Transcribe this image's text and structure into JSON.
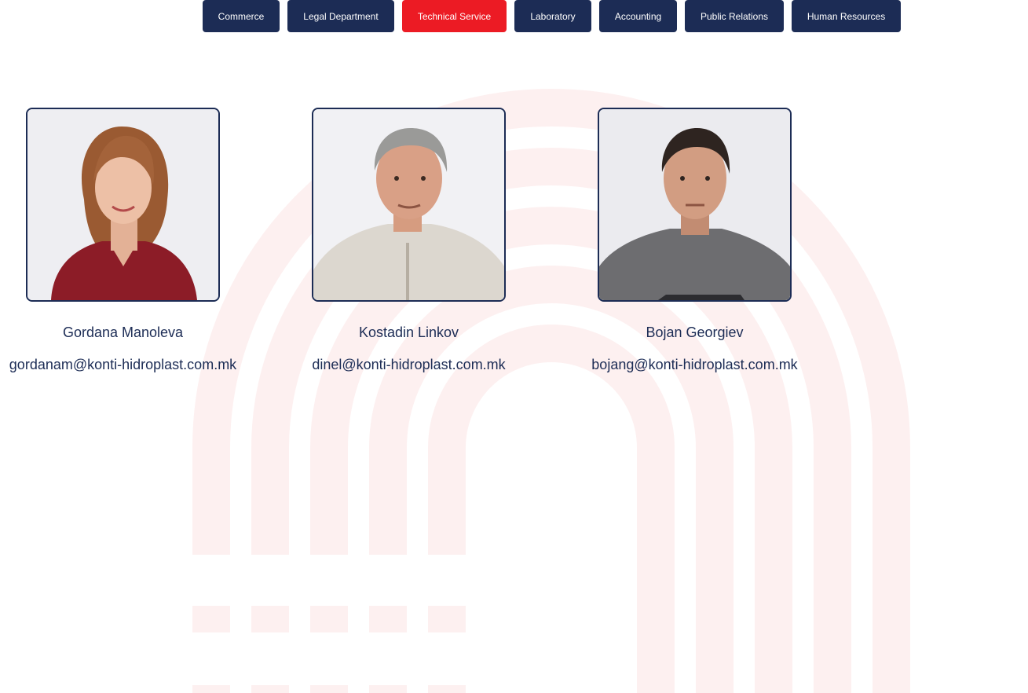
{
  "tabs": [
    {
      "label": "Commerce",
      "active": false
    },
    {
      "label": "Legal Department",
      "active": false
    },
    {
      "label": "Technical Service",
      "active": true
    },
    {
      "label": "Laboratory",
      "active": false
    },
    {
      "label": "Accounting",
      "active": false
    },
    {
      "label": "Public Relations",
      "active": false
    },
    {
      "label": "Human Resources",
      "active": false
    }
  ],
  "team": [
    {
      "name": "Gordana Manoleva",
      "email": "gordanam@konti-hidroplast.com.mk"
    },
    {
      "name": "Kostadin Linkov",
      "email": "dinel@konti-hidroplast.com.mk"
    },
    {
      "name": "Bojan Georgiev",
      "email": "bojang@konti-hidroplast.com.mk"
    }
  ],
  "colors": {
    "tab_bg": "#1c2c55",
    "tab_active_bg": "#ec1b24",
    "text": "#1c2c55",
    "watermark": "#fdf1f1"
  }
}
